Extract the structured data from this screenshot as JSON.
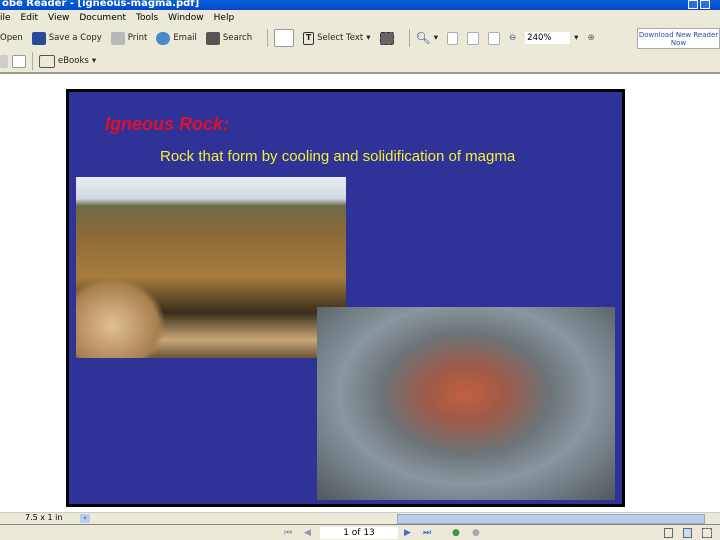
{
  "window": {
    "title": "obe Reader - [igneous-magma.pdf]"
  },
  "menu": [
    "ile",
    "Edit",
    "View",
    "Document",
    "Tools",
    "Window",
    "Help"
  ],
  "toolbar": {
    "open": "Open",
    "save_copy": "Save a Copy",
    "print": "Print",
    "email": "Email",
    "search": "Search",
    "select_text": "Select Text",
    "zoom_value": "240%",
    "ebooks": "eBooks",
    "download": "Download New Reader Now"
  },
  "slide": {
    "title": "Igneous Rock:",
    "subtitle": "Rock that form by cooling and solidification of magma"
  },
  "status": {
    "page_size": "7.5 x 1 in",
    "page_indicator": "1 of 13"
  }
}
